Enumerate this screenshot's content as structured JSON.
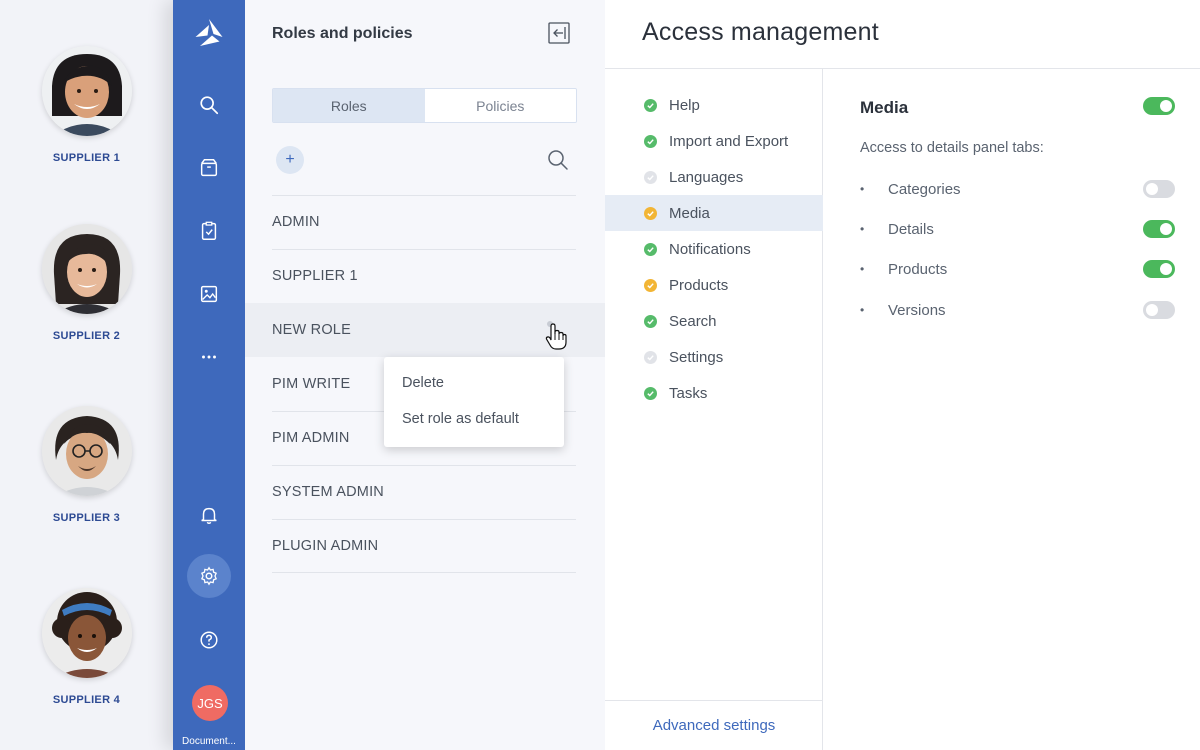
{
  "suppliers": [
    {
      "label": "SUPPLIER 1"
    },
    {
      "label": "SUPPLIER 2"
    },
    {
      "label": "SUPPLIER 3"
    },
    {
      "label": "SUPPLIER 4"
    }
  ],
  "nav": {
    "items": [
      "logo-icon",
      "search-icon",
      "box-icon",
      "clipboard-check-icon",
      "image-icon",
      "more-icon",
      "bell-icon",
      "gear-icon",
      "help-icon"
    ],
    "active": "gear-icon",
    "user_initials": "JGS",
    "user_caption": "Document..."
  },
  "roles_panel": {
    "title": "Roles and policies",
    "tabs": [
      {
        "label": "Roles",
        "active": true
      },
      {
        "label": "Policies",
        "active": false
      }
    ],
    "add_label": "+",
    "roles": [
      "ADMIN",
      "SUPPLIER 1",
      "NEW ROLE",
      "PIM WRITE",
      "PIM ADMIN",
      "SYSTEM ADMIN",
      "PLUGIN ADMIN"
    ],
    "hovered_role": "NEW ROLE",
    "context_menu": [
      "Delete",
      "Set role as default"
    ]
  },
  "access": {
    "title": "Access management",
    "modules": [
      {
        "label": "Help",
        "status": "green"
      },
      {
        "label": "Import and Export",
        "status": "green"
      },
      {
        "label": "Languages",
        "status": "grey"
      },
      {
        "label": "Media",
        "status": "yellow",
        "active": true
      },
      {
        "label": "Notifications",
        "status": "green"
      },
      {
        "label": "Products",
        "status": "yellow"
      },
      {
        "label": "Search",
        "status": "green"
      },
      {
        "label": "Settings",
        "status": "grey"
      },
      {
        "label": "Tasks",
        "status": "green"
      }
    ],
    "advanced_label": "Advanced settings",
    "detail": {
      "title": "Media",
      "enabled": true,
      "subtitle": "Access to details panel tabs:",
      "bullet": "•",
      "permissions": [
        {
          "label": "Categories",
          "enabled": false
        },
        {
          "label": "Details",
          "enabled": true
        },
        {
          "label": "Products",
          "enabled": true
        },
        {
          "label": "Versions",
          "enabled": false
        }
      ]
    }
  },
  "colors": {
    "rail": "#3e69bc",
    "accent": "#3e69bc",
    "toggle_on": "#4bb85c",
    "toggle_off": "#d9dbe0",
    "status_green": "#56bb6a",
    "status_yellow": "#f2b535",
    "status_grey": "#e1e3e8",
    "avatar_user": "#ef6b63"
  }
}
